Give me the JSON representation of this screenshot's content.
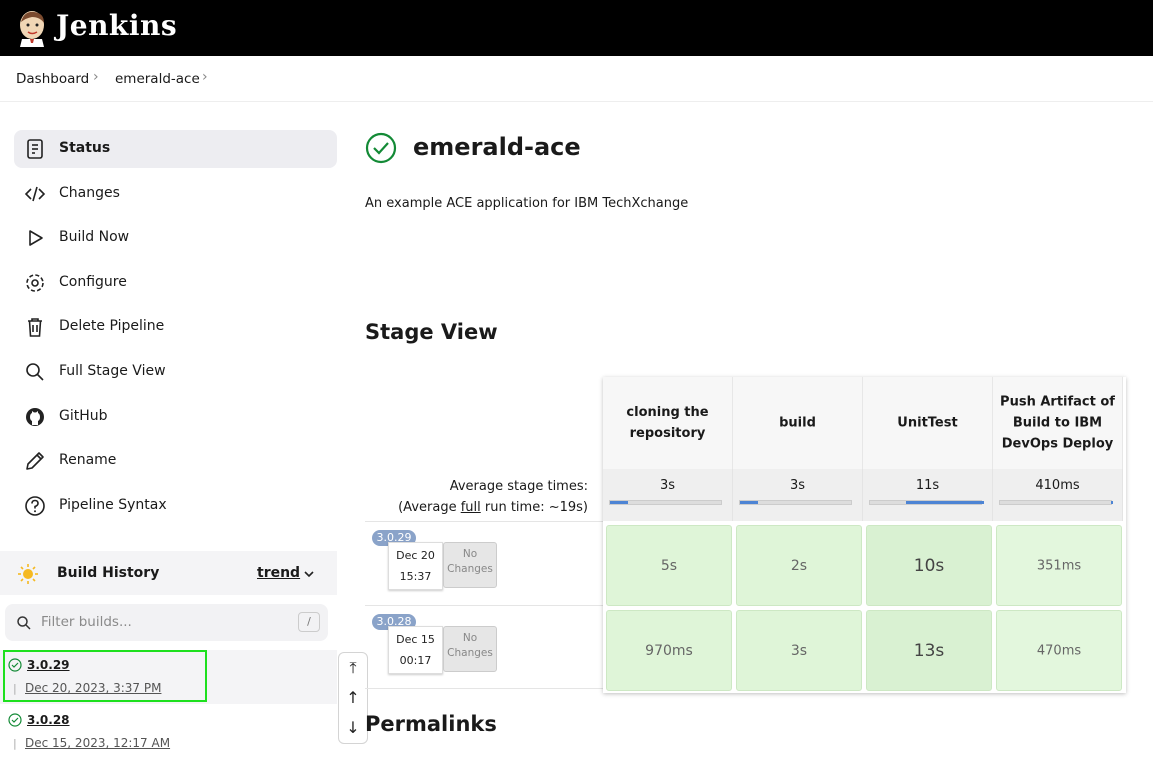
{
  "header": {
    "brand": "Jenkins"
  },
  "breadcrumb": [
    "Dashboard",
    "emerald-ace"
  ],
  "sidebar": {
    "items": [
      {
        "label": "Status",
        "icon": "status-doc-icon"
      },
      {
        "label": "Changes",
        "icon": "code-icon"
      },
      {
        "label": "Build Now",
        "icon": "play-icon"
      },
      {
        "label": "Configure",
        "icon": "gear-icon"
      },
      {
        "label": "Delete Pipeline",
        "icon": "trash-icon"
      },
      {
        "label": "Full Stage View",
        "icon": "search-icon"
      },
      {
        "label": "GitHub",
        "icon": "github-icon"
      },
      {
        "label": "Rename",
        "icon": "pencil-icon"
      },
      {
        "label": "Pipeline Syntax",
        "icon": "help-icon"
      }
    ]
  },
  "build_history": {
    "title": "Build History",
    "trend": "trend",
    "filter_placeholder": "Filter builds...",
    "shortcut": "/",
    "builds": [
      {
        "number": "3.0.29",
        "date": "Dec 20, 2023, 3:37 PM"
      },
      {
        "number": "3.0.28",
        "date": "Dec 15, 2023, 12:17 AM"
      }
    ]
  },
  "main": {
    "title": "emerald-ace",
    "description": "An example ACE application for IBM TechXchange",
    "stage_view_title": "Stage View",
    "permalinks_title": "Permalinks",
    "avg_label_1": "Average stage times:",
    "avg_label_2a": "(Average ",
    "avg_label_2b": "full",
    "avg_label_2c": " run time: ~19s)"
  },
  "stage_view": {
    "stages": [
      {
        "name": "cloning the repository",
        "avg": "3s",
        "avg_fill": 0.16
      },
      {
        "name": "build",
        "avg": "3s",
        "avg_fill": 0.16
      },
      {
        "name": "UnitTest",
        "avg": "11s",
        "avg_fill": 0.68
      },
      {
        "name": "Push Artifact of Build to IBM DevOps Deploy",
        "avg": "410ms",
        "avg_fill": 0.02
      }
    ],
    "runs": [
      {
        "tag": "3.0.29",
        "date": "Dec 20",
        "time": "15:37",
        "changes_1": "No",
        "changes_2": "Changes",
        "durations": [
          "5s",
          "2s",
          "10s",
          "351ms"
        ]
      },
      {
        "tag": "3.0.28",
        "date": "Dec 15",
        "time": "00:17",
        "changes_1": "No",
        "changes_2": "Changes",
        "durations": [
          "970ms",
          "3s",
          "13s",
          "470ms"
        ]
      }
    ]
  },
  "colors": {
    "success": "#138a36",
    "highlight": "#1ee01e",
    "stage_ok": "#dff5d8",
    "bar": "#4d84d4"
  }
}
